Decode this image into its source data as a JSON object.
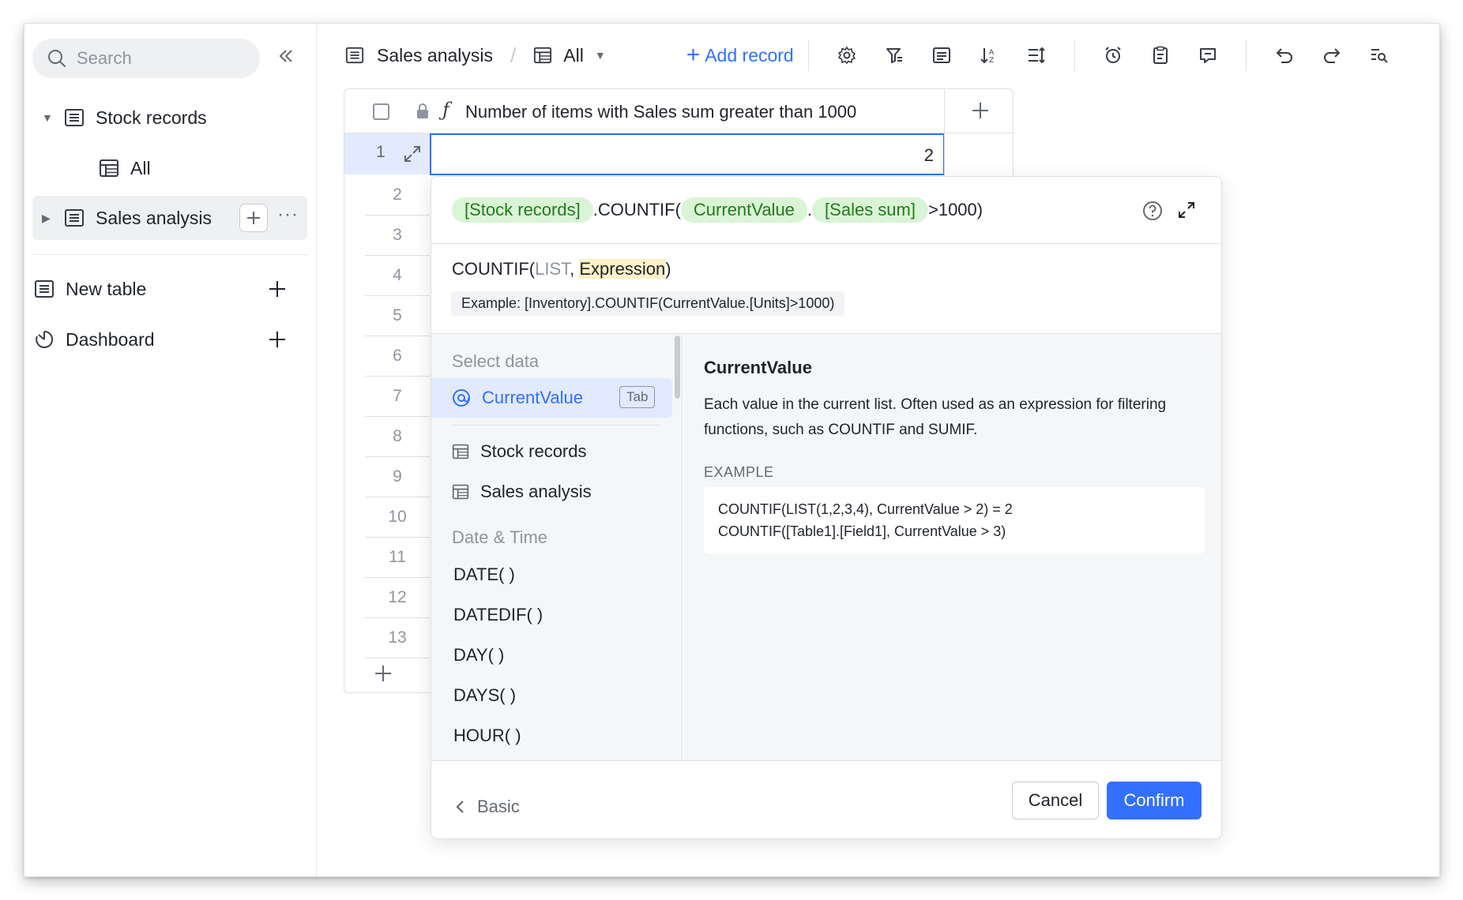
{
  "sidebar": {
    "search_placeholder": "Search",
    "items": [
      {
        "label": "Stock records"
      },
      {
        "label": "All"
      },
      {
        "label": "Sales analysis"
      }
    ],
    "new_table": "New table",
    "dashboard": "Dashboard"
  },
  "toolbar": {
    "table_name": "Sales analysis",
    "view_name": "All",
    "add_record": "Add record",
    "icons": [
      "settings-icon",
      "filter-icon",
      "group-icon",
      "sort-icon",
      "row-height-icon",
      "reminder-icon",
      "form-icon",
      "comment-icon",
      "undo-icon",
      "redo-icon",
      "find-icon"
    ]
  },
  "grid": {
    "column_header": "Number of items with Sales sum greater than 1000",
    "rows": [
      "1",
      "2",
      "3",
      "4",
      "5",
      "6",
      "7",
      "8",
      "9",
      "10",
      "11",
      "12",
      "13"
    ],
    "cell_value": "2"
  },
  "formula": {
    "tokens": {
      "t1": "[Stock records]",
      "t2": ".COUNTIF(",
      "t3": "CurrentValue",
      "t4": ".",
      "t5": "[Sales sum]",
      "t6": ">1000)"
    },
    "signature": {
      "fn": "COUNTIF(",
      "arg1": "LIST",
      "comma": ", ",
      "arg2": "Expression",
      "close": ")"
    },
    "example": "Example: [Inventory].COUNTIF(CurrentValue.[Units]>1000)",
    "list": {
      "group_select": "Select data",
      "selected": "CurrentValue",
      "tab_hint": "Tab",
      "tables": [
        "Stock records",
        "Sales analysis"
      ],
      "group_datetime": "Date & Time",
      "functions": [
        "DATE( )",
        "DATEDIF( )",
        "DAY( )",
        "DAYS( )",
        "HOUR( )"
      ]
    },
    "detail": {
      "title": "CurrentValue",
      "description": "Each value in the current list. Often used as an expression for filtering functions, such as COUNTIF and SUMIF.",
      "example_label": "EXAMPLE",
      "example_lines": [
        "COUNTIF(LIST(1,2,3,4), CurrentValue > 2) = 2",
        "COUNTIF([Table1].[Field1], CurrentValue > 3)"
      ]
    },
    "back_label": "Basic",
    "cancel": "Cancel",
    "confirm": "Confirm"
  },
  "colors": {
    "accent": "#3370ff",
    "token_bg": "#d9f5d6",
    "token_text": "#237b19",
    "selection_bg": "#e1eaff"
  }
}
